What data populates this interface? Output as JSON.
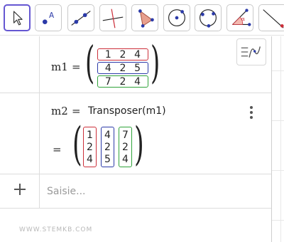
{
  "toolbar": {
    "tools": [
      {
        "name": "move-tool",
        "active": true
      },
      {
        "name": "point-tool",
        "active": false,
        "label": "A"
      },
      {
        "name": "line-tool",
        "active": false
      },
      {
        "name": "perpendicular-tool",
        "active": false
      },
      {
        "name": "polygon-tool",
        "active": false
      },
      {
        "name": "circle-center-tool",
        "active": false
      },
      {
        "name": "circle-three-points-tool",
        "active": false
      },
      {
        "name": "angle-tool",
        "active": false,
        "label": "α"
      },
      {
        "name": "reflect-tool",
        "active": false
      }
    ]
  },
  "algebra": {
    "m1": {
      "name": "m1",
      "equals": "=",
      "rows": [
        [
          "1",
          "2",
          "4"
        ],
        [
          "4",
          "2",
          "5"
        ],
        [
          "7",
          "2",
          "4"
        ]
      ],
      "row_colors": [
        "#cc2f3a",
        "#2b3aa8",
        "#2fa33a"
      ]
    },
    "m2": {
      "definition_name": "m2",
      "definition_equals": "=",
      "definition_command": "Transposer(m1)",
      "result_equals": "=",
      "columns": [
        [
          "1",
          "2",
          "4"
        ],
        [
          "4",
          "2",
          "5"
        ],
        [
          "7",
          "2",
          "4"
        ]
      ],
      "column_colors": [
        "#cc2f3a",
        "#2b3aa8",
        "#2fa33a"
      ]
    },
    "input": {
      "placeholder": "Saisie..."
    }
  },
  "watermark": "WWW.STEMKB.COM"
}
